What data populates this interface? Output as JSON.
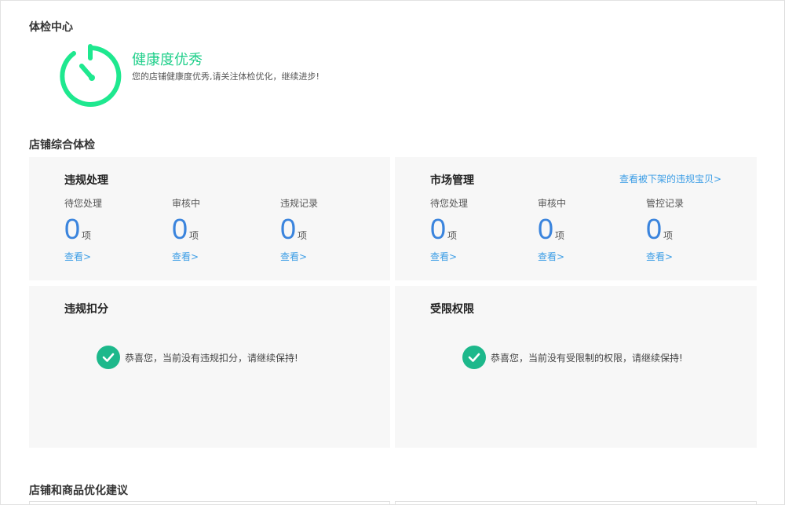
{
  "health": {
    "section_title": "体检中心",
    "title": "健康度优秀",
    "desc": "您的店铺健康度优秀,请关注体检优化，继续进步!"
  },
  "overall": {
    "section_title": "店铺综合体检",
    "violation": {
      "title": "违规处理",
      "stats": [
        {
          "label": "待您处理",
          "value": "0",
          "unit": "项",
          "link": "查看>"
        },
        {
          "label": "审核中",
          "value": "0",
          "unit": "项",
          "link": "查看>"
        },
        {
          "label": "违规记录",
          "value": "0",
          "unit": "项",
          "link": "查看>"
        }
      ]
    },
    "market": {
      "title": "市场管理",
      "link": "查看被下架的违规宝贝>",
      "stats": [
        {
          "label": "待您处理",
          "value": "0",
          "unit": "项",
          "link": "查看>"
        },
        {
          "label": "审核中",
          "value": "0",
          "unit": "项",
          "link": "查看>"
        },
        {
          "label": "管控记录",
          "value": "0",
          "unit": "项",
          "link": "查看>"
        }
      ]
    },
    "deduction": {
      "title": "违规扣分",
      "notice": "恭喜您，当前没有违规扣分，请继续保持!"
    },
    "restriction": {
      "title": "受限权限",
      "notice": "恭喜您，当前没有受限制的权限，请继续保持!"
    }
  },
  "suggestion": {
    "section_title": "店铺和商品优化建议"
  },
  "colors": {
    "accent_green": "#1fcf8a",
    "number_blue": "#3a84dd",
    "link_blue": "#3d9ee6",
    "check_green": "#1db88b"
  }
}
